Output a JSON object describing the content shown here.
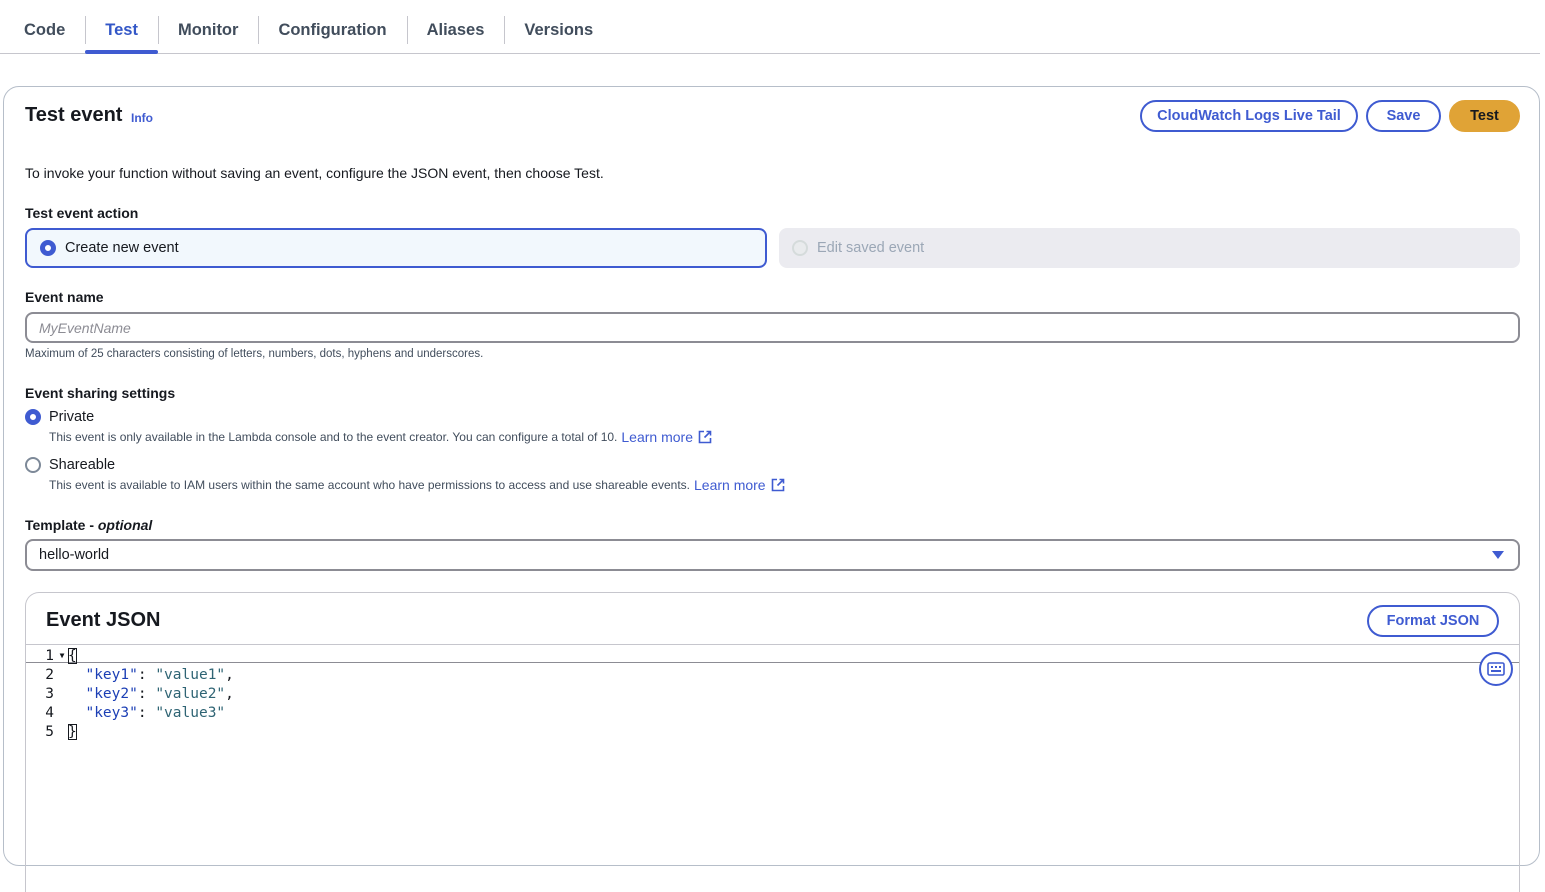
{
  "tabs": [
    {
      "label": "Code",
      "active": false
    },
    {
      "label": "Test",
      "active": true
    },
    {
      "label": "Monitor",
      "active": false
    },
    {
      "label": "Configuration",
      "active": false
    },
    {
      "label": "Aliases",
      "active": false
    },
    {
      "label": "Versions",
      "active": false
    }
  ],
  "header": {
    "title": "Test event",
    "info": "Info",
    "buttons": {
      "cloudwatch": "CloudWatch Logs Live Tail",
      "save": "Save",
      "test": "Test"
    }
  },
  "intro": "To invoke your function without saving an event, configure the JSON event, then choose Test.",
  "test_event_action": {
    "label": "Test event action",
    "options": [
      {
        "label": "Create new event",
        "selected": true,
        "disabled": false
      },
      {
        "label": "Edit saved event",
        "selected": false,
        "disabled": true
      }
    ]
  },
  "event_name": {
    "label": "Event name",
    "placeholder": "MyEventName",
    "value": "",
    "hint": "Maximum of 25 characters consisting of letters, numbers, dots, hyphens and underscores."
  },
  "sharing": {
    "label": "Event sharing settings",
    "options": [
      {
        "label": "Private",
        "selected": true,
        "description": "This event is only available in the Lambda console and to the event creator. You can configure a total of 10.",
        "learn_more": "Learn more"
      },
      {
        "label": "Shareable",
        "selected": false,
        "description": "This event is available to IAM users within the same account who have permissions to access and use shareable events.",
        "learn_more": "Learn more"
      }
    ]
  },
  "template": {
    "label": "Template - ",
    "label_optional": "optional",
    "selected": "hello-world"
  },
  "event_json": {
    "title": "Event JSON",
    "format_button": "Format JSON",
    "lines": [
      {
        "num": "1",
        "fold": true,
        "text": "{"
      },
      {
        "num": "2",
        "key": "\"key1\"",
        "value": "\"value1\"",
        "trail": ","
      },
      {
        "num": "3",
        "key": "\"key2\"",
        "value": "\"value2\"",
        "trail": ","
      },
      {
        "num": "4",
        "key": "\"key3\"",
        "value": "\"value3\"",
        "trail": ""
      },
      {
        "num": "5",
        "fold": false,
        "text": "}"
      }
    ]
  },
  "icons": {
    "external": "external-link-icon",
    "keyboard": "keyboard-icon",
    "caret": "caret-down-icon"
  },
  "colors": {
    "accent": "#3f5bd1",
    "primary_button": "#e0a336"
  }
}
